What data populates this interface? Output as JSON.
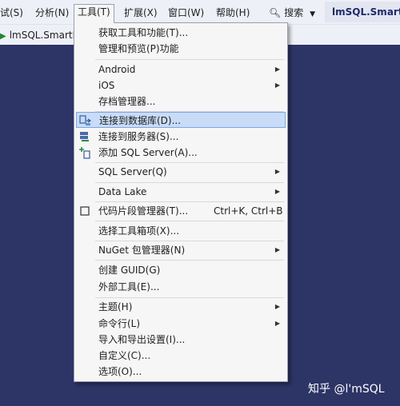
{
  "menubar": {
    "items": [
      {
        "label": "试(S)"
      },
      {
        "label": "分析(N)"
      },
      {
        "label": "工具(T)"
      },
      {
        "label": "扩展(X)"
      },
      {
        "label": "窗口(W)"
      },
      {
        "label": "帮助(H)"
      }
    ],
    "search_label": "搜索",
    "project_name": "lmSQL.SmartPa"
  },
  "toolbar": {
    "run_label": "lmSQL.SmartPa"
  },
  "menu": {
    "items": [
      {
        "label": "获取工具和功能(T)..."
      },
      {
        "label": "管理和预览(P)功能"
      },
      {
        "label": "Android"
      },
      {
        "label": "iOS"
      },
      {
        "label": "存档管理器..."
      },
      {
        "label": "连接到数据库(D)..."
      },
      {
        "label": "连接到服务器(S)..."
      },
      {
        "label": "添加 SQL Server(A)..."
      },
      {
        "label": "SQL Server(Q)"
      },
      {
        "label": "Data Lake"
      },
      {
        "label": "代码片段管理器(T)...",
        "shortcut": "Ctrl+K, Ctrl+B"
      },
      {
        "label": "选择工具箱项(X)..."
      },
      {
        "label": "NuGet 包管理器(N)"
      },
      {
        "label": "创建 GUID(G)"
      },
      {
        "label": "外部工具(E)..."
      },
      {
        "label": "主题(H)"
      },
      {
        "label": "命令行(L)"
      },
      {
        "label": "导入和导出设置(I)..."
      },
      {
        "label": "自定义(C)..."
      },
      {
        "label": "选项(O)..."
      }
    ]
  },
  "watermark": "知乎 @l'mSQL",
  "colors": {
    "background": "#2d3466",
    "menu_bg": "#f6f6f6",
    "highlight": "#c9dcf7",
    "highlight_border": "#7fa6e0"
  }
}
